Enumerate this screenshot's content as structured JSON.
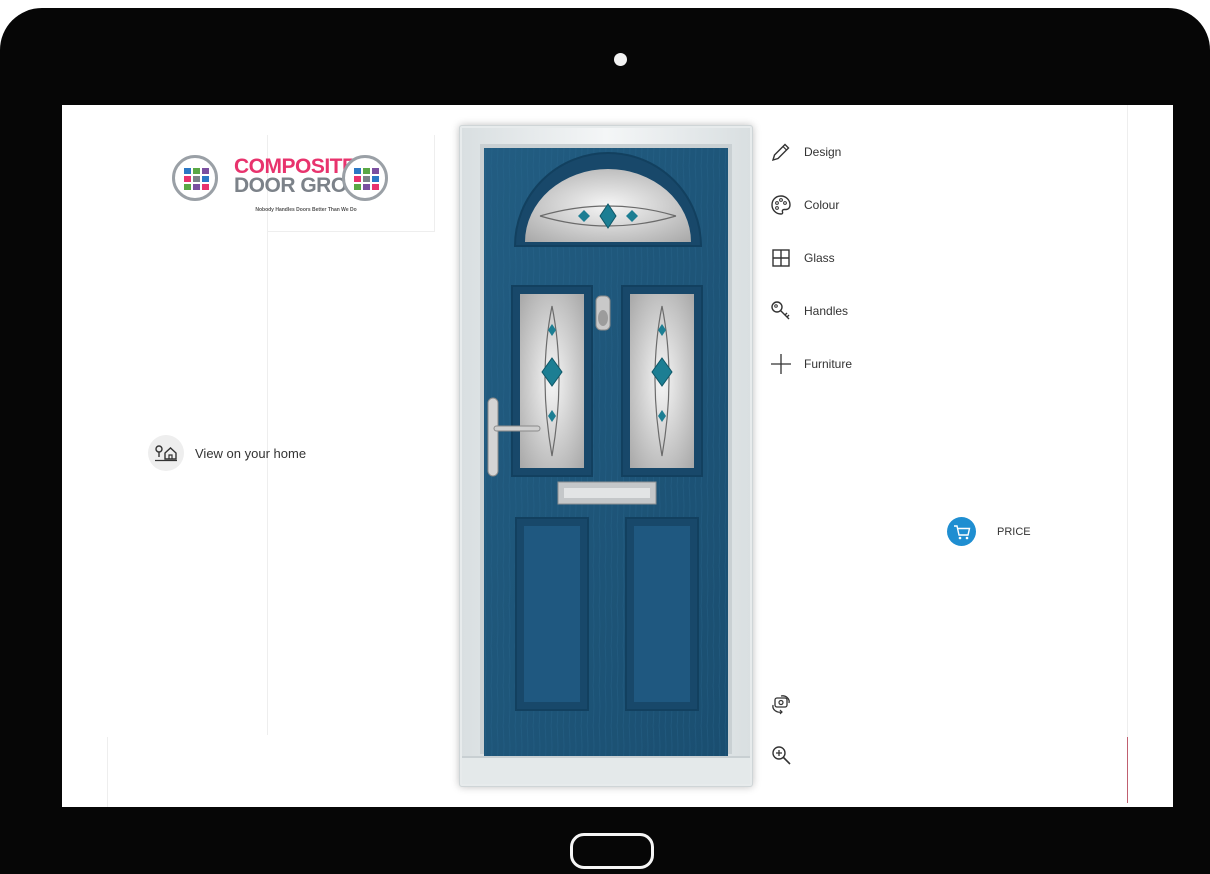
{
  "logo": {
    "line1": "COMPOSITE",
    "line2": "DOOR GROUP",
    "tagline": "Nobody Handles Doors Better Than We Do",
    "colors": {
      "pink": "#e8336d",
      "grey": "#7c8289",
      "blue": "#2b78c5",
      "green": "#5aa845",
      "purple": "#7b4fa0"
    }
  },
  "view_home": {
    "icon": "location-home-icon",
    "label": "View on your home"
  },
  "door": {
    "color": "#1e5679",
    "frame_color": "#e7ebec",
    "glass_accent": "#1c7e93"
  },
  "menu": [
    {
      "icon": "pencil-icon",
      "label": "Design"
    },
    {
      "icon": "palette-icon",
      "label": "Colour"
    },
    {
      "icon": "grid-icon",
      "label": "Glass"
    },
    {
      "icon": "key-icon",
      "label": "Handles"
    },
    {
      "icon": "plus-icon",
      "label": "Furniture"
    }
  ],
  "price": {
    "icon": "cart-icon",
    "label": "PRICE",
    "color": "#1f8ed1"
  },
  "tools": [
    {
      "icon": "rotate-view-icon"
    },
    {
      "icon": "zoom-in-icon"
    }
  ]
}
